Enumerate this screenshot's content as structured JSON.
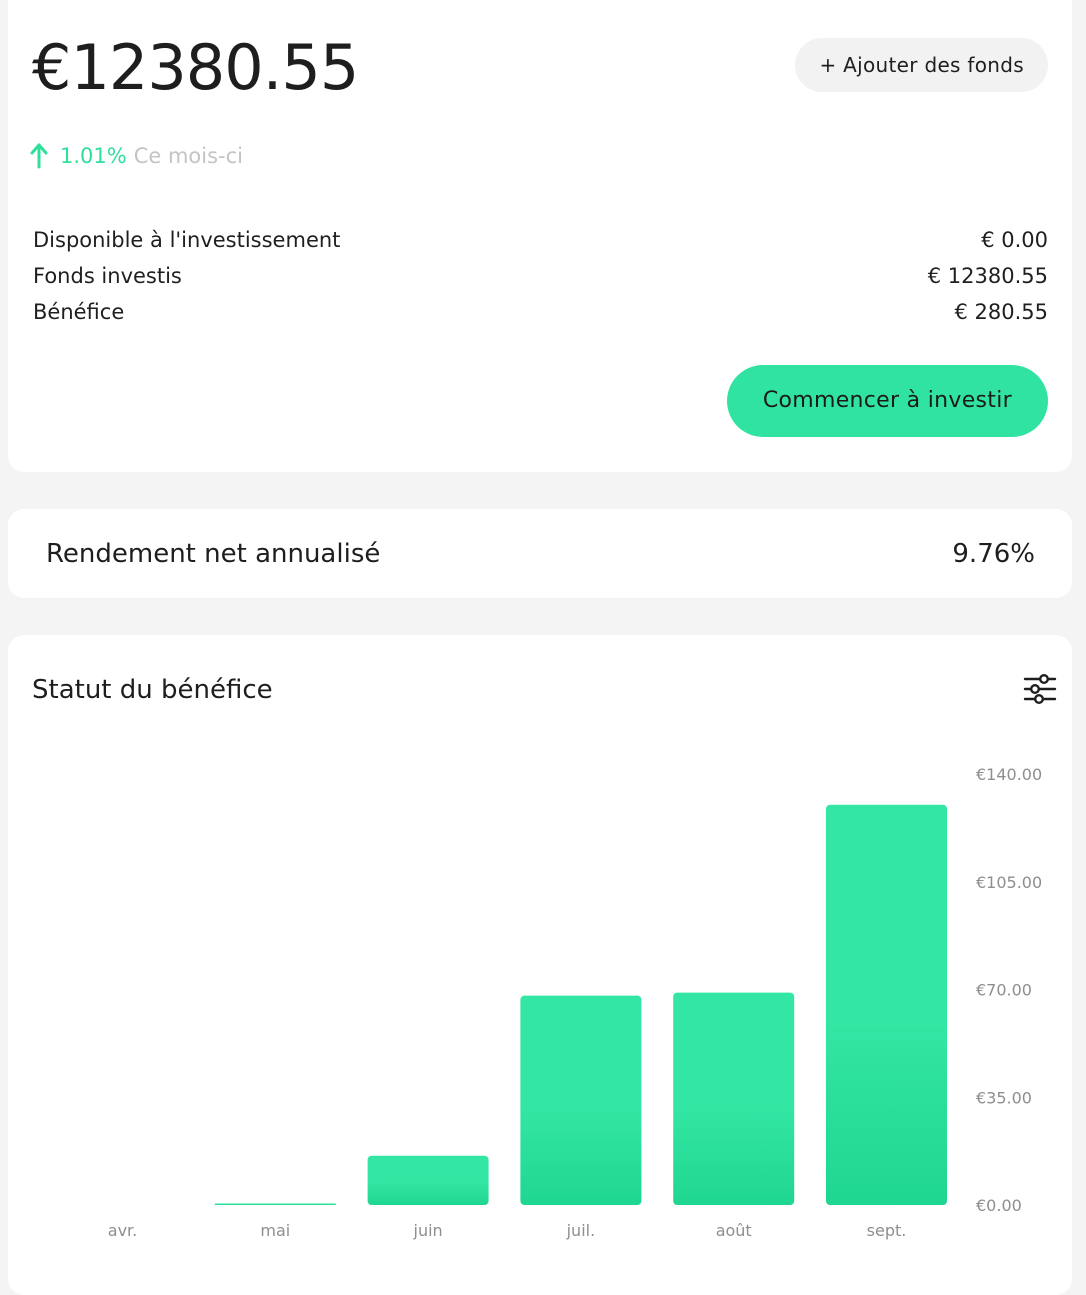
{
  "balance": {
    "amount": "€12380.55",
    "add_funds_label": "+ Ajouter des fonds",
    "change_pct": "1.01%",
    "change_period": "Ce mois-ci",
    "trend_direction": "up",
    "rows": [
      {
        "label": "Disponible à l'investissement",
        "value": "€ 0.00"
      },
      {
        "label": "Fonds investis",
        "value": "€ 12380.55"
      },
      {
        "label": "Bénéfice",
        "value": "€ 280.55"
      }
    ],
    "invest_button_label": "Commencer à investir"
  },
  "yield": {
    "label": "Rendement net annualisé",
    "value": "9.76%"
  },
  "chart_section": {
    "title": "Statut du bénéfice",
    "filter_icon": "sliders-icon"
  },
  "colors": {
    "accent": "#30e3a1",
    "bar_top": "#33e6a3",
    "bar_bottom": "#1fd690",
    "muted_text": "#8e8e8e"
  },
  "chart_data": {
    "type": "bar",
    "categories": [
      "avr.",
      "mai",
      "juin",
      "juil.",
      "août",
      "sept."
    ],
    "values": [
      0,
      0.5,
      16,
      68,
      69,
      130
    ],
    "y_ticks": [
      0,
      35,
      70,
      105,
      140
    ],
    "y_tick_labels": [
      "€0.00",
      "€35.00",
      "€70.00",
      "€105.00",
      "€140.00"
    ],
    "ylim": [
      0,
      140
    ],
    "y_axis_position": "right",
    "grid": false,
    "title": "Statut du bénéfice"
  }
}
